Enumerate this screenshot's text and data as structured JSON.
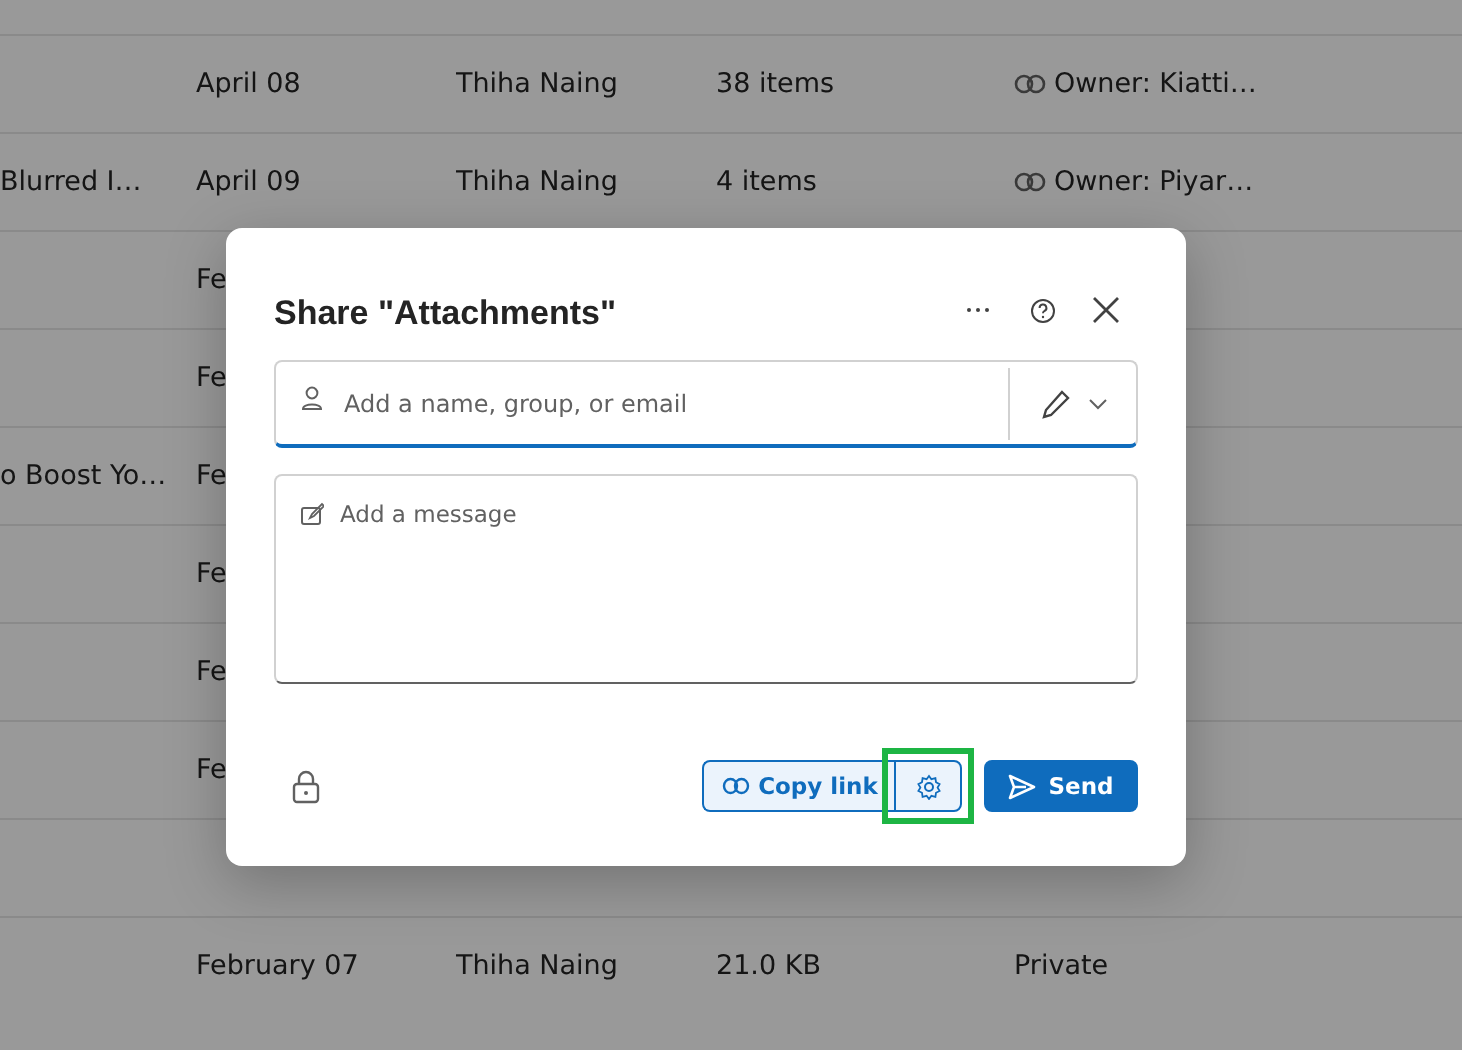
{
  "file_list": {
    "rows": [
      {
        "date": "April 08",
        "owner": "Thiha Naing",
        "size": "38 items",
        "sharing": "Owner: Kiatti…",
        "shared_link": true
      },
      {
        "name": "Blurred I…",
        "date": "April 09",
        "owner": "Thiha Naing",
        "size": "4 items",
        "sharing": "Owner: Piyar…",
        "shared_link": true
      },
      {
        "date": "Fe"
      },
      {
        "date": "Fe"
      },
      {
        "name": "o Boost Yo…",
        "date": "Fe"
      },
      {
        "date": "Fe"
      },
      {
        "date": "Fe"
      },
      {
        "date": "Fe"
      },
      {},
      {
        "date": "February 07",
        "owner": "Thiha Naing",
        "size": "21.0 KB",
        "sharing": "Private",
        "shared_link": false
      }
    ]
  },
  "share_dialog": {
    "title": "Share \"Attachments\"",
    "recipients": {
      "placeholder": "Add a name, group, or email"
    },
    "message": {
      "placeholder": "Add a message"
    },
    "copy_link": {
      "label": "Copy link"
    },
    "link_settings": {
      "highlighted": true
    },
    "send": {
      "label": "Send"
    }
  }
}
